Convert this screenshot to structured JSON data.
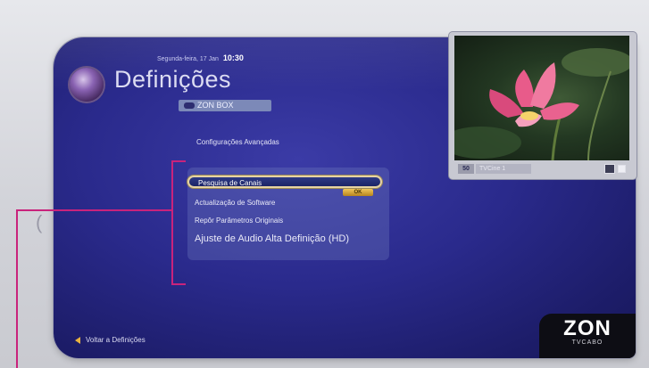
{
  "header": {
    "date": "Segunda-feira, 17 Jan",
    "time": "10:30",
    "title": "Definições",
    "device_label": "ZON BOX"
  },
  "menu": {
    "section_title": "Configurações Avançadas",
    "items": [
      {
        "label": "Pesquisa de Canais",
        "selected": true
      },
      {
        "label": "Actualização de Software"
      },
      {
        "label": "Repôr Parâmetros Originais"
      },
      {
        "label": "Ajuste de Audio Alta Definição (HD)"
      }
    ],
    "ok_tag": "OK"
  },
  "preview": {
    "channel_number": "50",
    "channel_name": "TVCine 1"
  },
  "footer": {
    "back_label": "Voltar a Definições",
    "brand": "ZON",
    "brand_sub": "TVCABO"
  },
  "colors": {
    "background_blue": "#2a2a8c",
    "accent_magenta": "#c9237c",
    "highlight_gold": "#e7d4a2"
  }
}
